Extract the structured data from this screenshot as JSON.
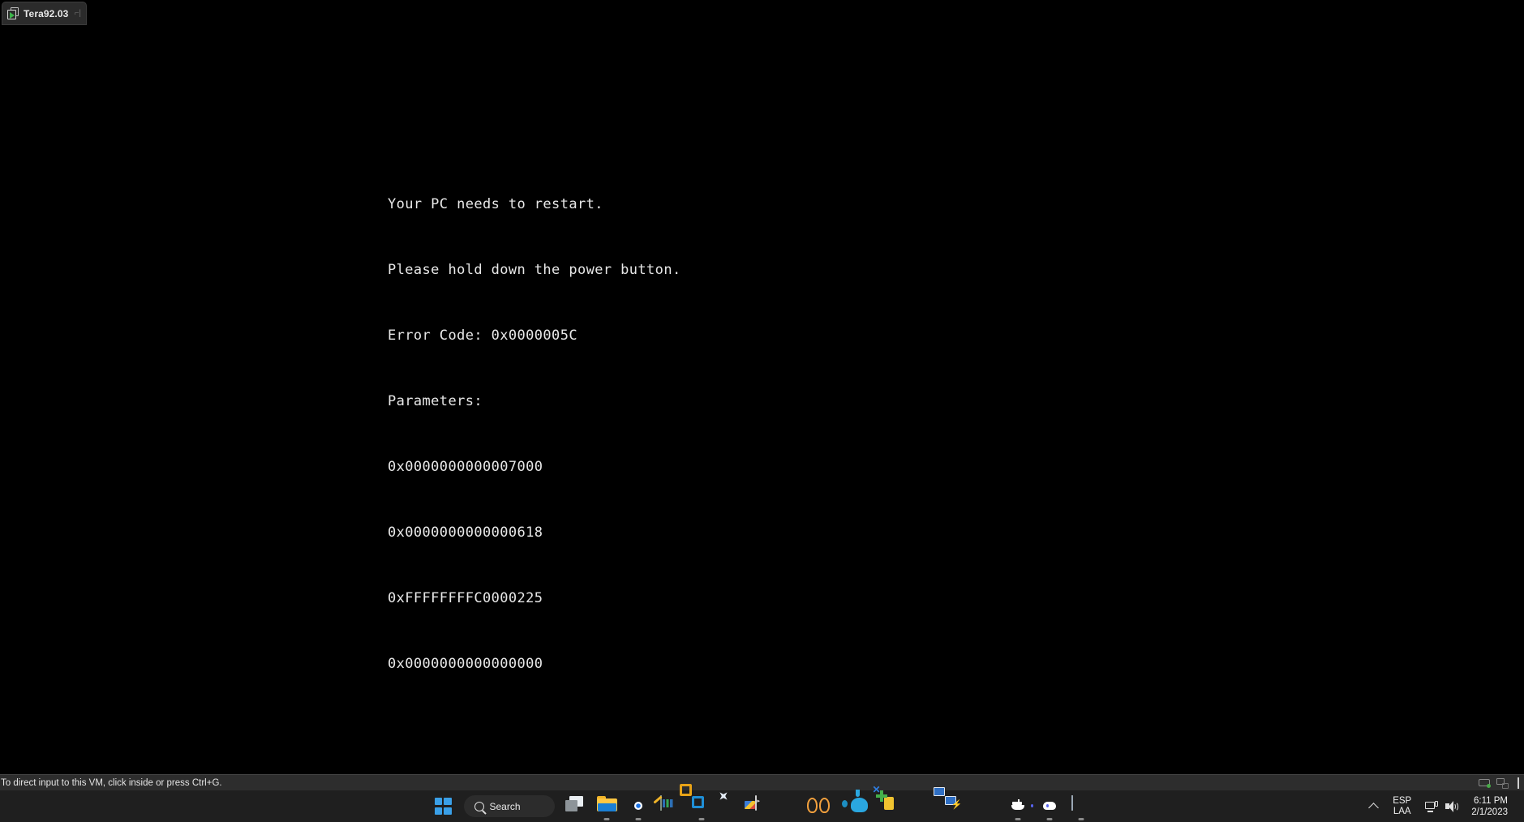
{
  "vm_window": {
    "tab": {
      "title": "Tera92.03",
      "icon": "vm-screen-icon",
      "trailing": "⌐|"
    },
    "guest": {
      "bsod_lines": [
        "Your PC needs to restart.",
        "Please hold down the power button.",
        "Error Code: 0x0000005C",
        "Parameters:",
        "0x0000000000007000",
        "0x0000000000000618",
        "0xFFFFFFFFC0000225",
        "0x0000000000000000"
      ],
      "error_code": "0x0000005C",
      "parameters": [
        "0x0000000000007000",
        "0x0000000000000618",
        "0xFFFFFFFFC0000225",
        "0x0000000000000000"
      ],
      "background_color": "#000000",
      "text_color": "#e6e6e6"
    },
    "statusbar": {
      "hint": "To direct input to this VM, click inside or press Ctrl+G.",
      "icons": [
        {
          "name": "hard-disk-icon",
          "label": "Hard Disk"
        },
        {
          "name": "network-adapter-icon",
          "label": "Network Adapter"
        }
      ]
    }
  },
  "taskbar": {
    "start": {
      "label": "Start",
      "icon": "windows-logo-icon"
    },
    "search": {
      "label": "Search",
      "placeholder": "Search",
      "icon": "search-icon"
    },
    "items": [
      {
        "name": "task-view",
        "label": "Task View",
        "icon": "task-view-icon",
        "running": false
      },
      {
        "name": "file-explorer",
        "label": "File Explorer",
        "icon": "folder-icon",
        "running": true
      },
      {
        "name": "google-chrome",
        "label": "Google Chrome",
        "icon": "chrome-icon",
        "running": true
      },
      {
        "name": "notepad",
        "label": "Notepad",
        "icon": "notepad-icon",
        "running": false
      },
      {
        "name": "vmware-workstation",
        "label": "VMware Workstation",
        "icon": "vmware-icon",
        "running": true
      },
      {
        "name": "vmware-player",
        "label": "VMware Player",
        "icon": "compass-icon",
        "running": false
      },
      {
        "name": "screentogif",
        "label": "ScreenToGif",
        "icon": "screen-recorder-icon",
        "running": false
      },
      {
        "name": "visual-studio-code",
        "label": "Visual Studio Code",
        "icon": "vscode-icon",
        "running": false
      },
      {
        "name": "navicat",
        "label": "Navicat",
        "icon": "navicat-icon",
        "running": false
      },
      {
        "name": "postgresql",
        "label": "PostgreSQL",
        "icon": "elephant-icon",
        "running": false
      },
      {
        "name": "sublime-tools",
        "label": "Editor Tools",
        "icon": "gold-plate-icon",
        "running": false
      },
      {
        "name": "visual-studio",
        "label": "Visual Studio",
        "icon": "visual-studio-icon",
        "running": false
      },
      {
        "name": "remote-desktop",
        "label": "Remote Desktop",
        "icon": "remote-desktop-icon",
        "running": false
      },
      {
        "name": "bat-app",
        "label": "The Bat!",
        "icon": "bat-icon",
        "running": false
      },
      {
        "name": "docker-desktop",
        "label": "Docker Desktop",
        "icon": "docker-icon",
        "running": true
      },
      {
        "name": "discord",
        "label": "Discord",
        "icon": "discord-icon",
        "running": true
      },
      {
        "name": "performance-monitor",
        "label": "Performance Monitor",
        "icon": "perf-chart-icon",
        "running": true
      }
    ],
    "tray": {
      "chevron": {
        "name": "show-hidden-icons",
        "label": "Show hidden icons"
      },
      "language": {
        "line1": "ESP",
        "line2": "LAA"
      },
      "network": {
        "name": "network-icon",
        "label": "Network"
      },
      "volume": {
        "name": "volume-icon",
        "label": "Volume"
      },
      "clock": {
        "time": "6:11 PM",
        "date": "2/1/2023"
      }
    }
  }
}
